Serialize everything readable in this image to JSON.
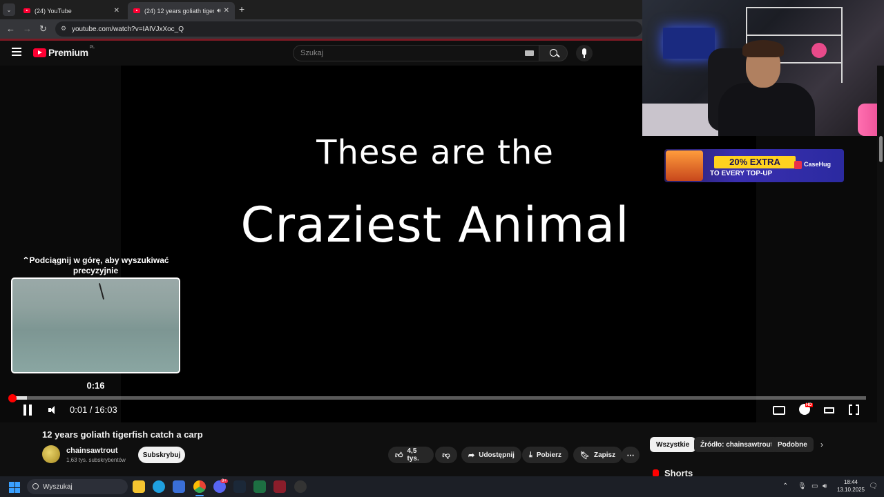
{
  "browser": {
    "tabs": [
      {
        "label": "(24) YouTube",
        "active": false
      },
      {
        "label": "(24) 12 years goliath tigerfis",
        "active": true
      }
    ],
    "url": "youtube.com/watch?v=IAIVJxXoc_Q"
  },
  "header": {
    "logo_text": "Premium",
    "logo_region": "PL",
    "search_placeholder": "Szukaj"
  },
  "player": {
    "overlay_line1": "These are the",
    "overlay_line2": "Craziest Animal",
    "seek_hint": "Podciągnij w górę, aby wyszukiwać precyzyjnie",
    "preview_time": "0:16",
    "current_time": "0:01",
    "duration": "16:03",
    "time_display": "0:01 / 16:03",
    "played_fraction": 0.001,
    "buffered_fraction": 0.018,
    "quality_badge": "HD"
  },
  "video": {
    "title": "12 years goliath tigerfish catch a carp",
    "channel": "chainsawtrout",
    "subscribers": "1,63 tys. subskrybentów",
    "subscribe_label": "Subskrybuj",
    "like_count": "4,5 tys.",
    "share_label": "Udostępnij",
    "download_label": "Pobierz",
    "save_label": "Zapisz"
  },
  "sidebar": {
    "chips": [
      {
        "label": "Wszystkie",
        "selected": true
      },
      {
        "label": "Źródło: chainsawtrout",
        "selected": false
      },
      {
        "label": "Podobne",
        "selected": false
      }
    ],
    "shorts_label": "Shorts"
  },
  "ad": {
    "headline": "20% EXTRA",
    "subline": "TO EVERY TOP-UP",
    "brand": "CaseHug"
  },
  "taskbar": {
    "search_label": "Wyszukaj",
    "time": "18:44",
    "date": "13.10.2025",
    "discord_badge": "9+"
  },
  "colors": {
    "youtube_red": "#ff0033",
    "progress_red": "#ff0000",
    "background": "#0f0f0f"
  }
}
